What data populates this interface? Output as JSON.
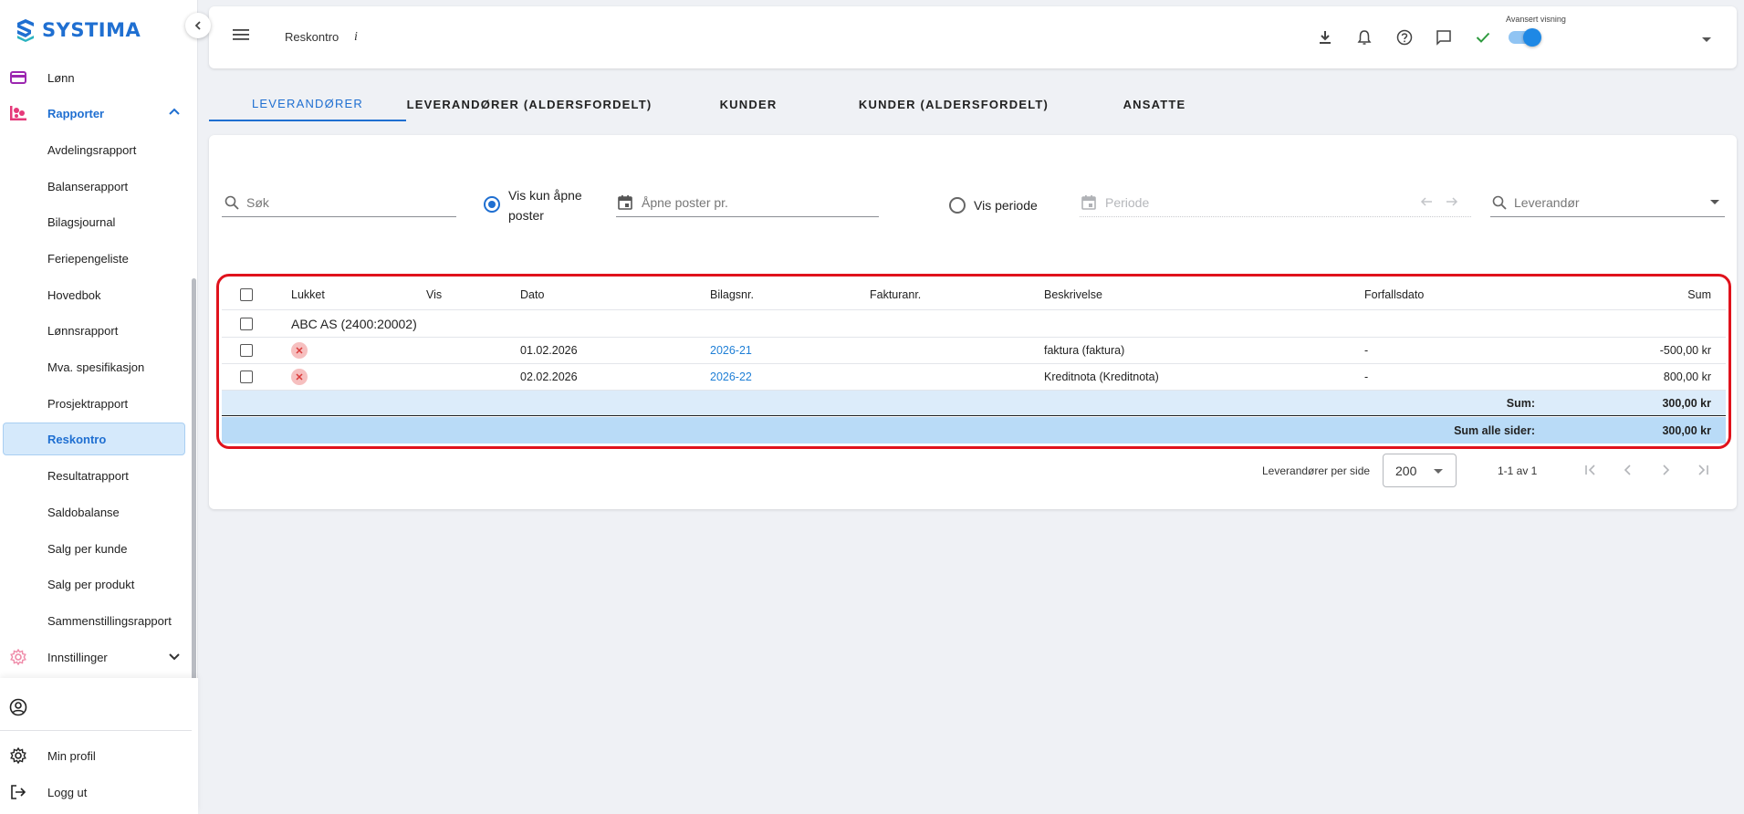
{
  "app": {
    "name": "SYSTIMA"
  },
  "sidebar": {
    "items": [
      {
        "label": "Lønn",
        "icon": "card-icon"
      },
      {
        "label": "Rapporter",
        "icon": "report-icon"
      },
      {
        "label": "Avdelingsrapport"
      },
      {
        "label": "Balanserapport"
      },
      {
        "label": "Bilagsjournal"
      },
      {
        "label": "Feriepengeliste"
      },
      {
        "label": "Hovedbok"
      },
      {
        "label": "Lønnsrapport"
      },
      {
        "label": "Mva. spesifikasjon"
      },
      {
        "label": "Prosjektrapport"
      },
      {
        "label": "Reskontro"
      },
      {
        "label": "Resultatrapport"
      },
      {
        "label": "Saldobalanse"
      },
      {
        "label": "Salg per kunde"
      },
      {
        "label": "Salg per produkt"
      },
      {
        "label": "Sammenstillingsrapport"
      },
      {
        "label": "Innstillinger",
        "icon": "gear-icon"
      }
    ],
    "bottom": {
      "profile": "Min profil",
      "logout": "Logg ut"
    }
  },
  "header": {
    "title": "Reskontro",
    "info": "i",
    "advanced_label": "Avansert visning",
    "advanced_on": true
  },
  "tabs": [
    {
      "label": "LEVERANDØRER",
      "active": true
    },
    {
      "label": "LEVERANDØRER (ALDERSFORDELT)"
    },
    {
      "label": "KUNDER"
    },
    {
      "label": "KUNDER (ALDERSFORDELT)"
    },
    {
      "label": "ANSATTE"
    }
  ],
  "filters": {
    "search_placeholder": "Søk",
    "radio_open_label_1": "Vis kun åpne",
    "radio_open_label_2": "poster",
    "open_posts_placeholder": "Åpne poster pr.",
    "radio_period_label": "Vis periode",
    "period_placeholder": "Periode",
    "supplier_placeholder": "Leverandør"
  },
  "table": {
    "columns": [
      "Lukket",
      "Vis",
      "Dato",
      "Bilagsnr.",
      "Fakturanr.",
      "Beskrivelse",
      "Forfallsdato",
      "Sum"
    ],
    "group": "ABC AS (2400:20002)",
    "rows": [
      {
        "date": "01.02.2026",
        "voucher": "2026-21",
        "invoice": "",
        "description": "faktura (faktura)",
        "due": "-",
        "sum": "-500,00 kr"
      },
      {
        "date": "02.02.2026",
        "voucher": "2026-22",
        "invoice": "",
        "description": "Kreditnota (Kreditnota)",
        "due": "-",
        "sum": "800,00 kr"
      }
    ],
    "sum_label": "Sum:",
    "sum_value": "300,00 kr",
    "sum_all_label": "Sum alle sider:",
    "sum_all_value": "300,00 kr"
  },
  "pagination": {
    "per_page_label": "Leverandører per side",
    "per_page_value": "200",
    "range": "1-1 av 1"
  },
  "colors": {
    "accent": "#1f6fd1",
    "highlight": "#e0121c",
    "sum_row": "#dcecfa",
    "sum_all_row": "#b9dbf7"
  }
}
